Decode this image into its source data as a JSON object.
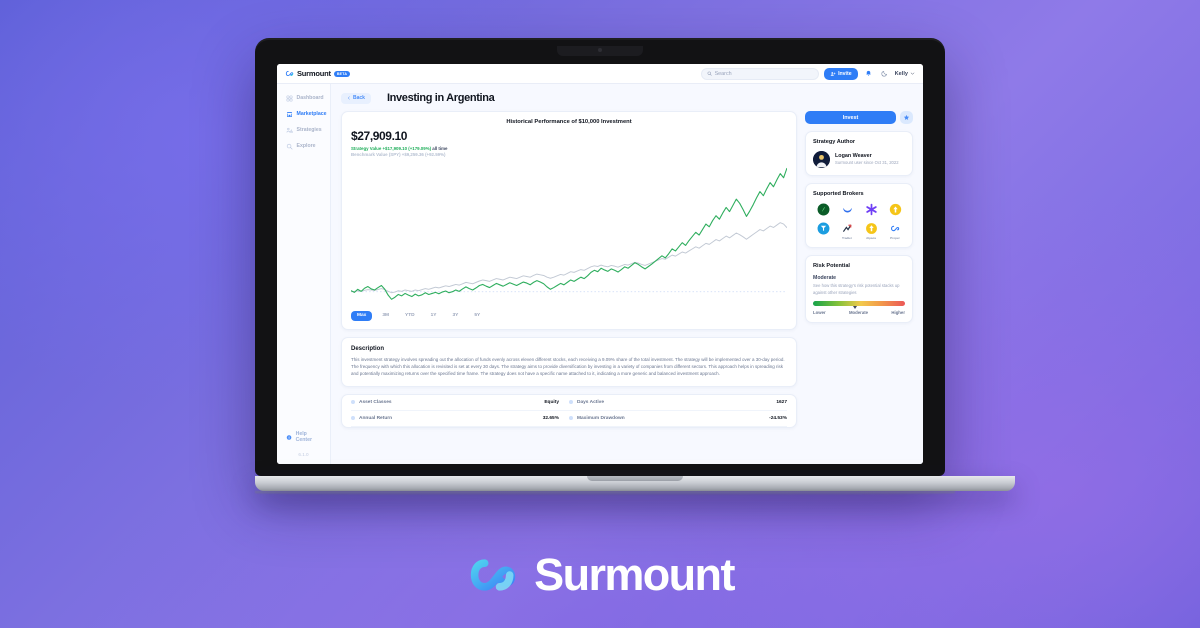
{
  "brand": {
    "name": "Surmount",
    "pill": "BETA",
    "footer_name": "Surmount",
    "logo_icon": "surmount-infinity-logo"
  },
  "topbar": {
    "search_placeholder": "Search",
    "invite_label": "Invite",
    "invite_icon": "add-people-icon",
    "notifications_icon": "bell-icon",
    "theme_icon": "moon-icon",
    "user_name": "Kelly",
    "user_caret": "⌄"
  },
  "sidebar": {
    "items": [
      {
        "label": "Dashboard",
        "icon": "dashboard-grid-icon",
        "active": false
      },
      {
        "label": "Marketplace",
        "icon": "storefront-icon",
        "active": true
      },
      {
        "label": "Strategies",
        "icon": "people-chart-icon",
        "active": false
      },
      {
        "label": "Explore",
        "icon": "magnifier-icon",
        "active": false
      }
    ],
    "help_label": "Help Center",
    "help_icon": "info-circle-icon",
    "version": "6.1.0"
  },
  "page": {
    "back_label": "Back",
    "back_icon": "chevron-left-icon",
    "title": "Investing in Argentina"
  },
  "chart_card": {
    "caption": "Historical Performance of $10,000 Investment",
    "big_value": "$27,909.10",
    "strategy_legend": "Strategy Value +$17,909.10 (+179.09%)",
    "strategy_period": "all time",
    "benchmark_legend": "Benchmark Value (SPY) +$9,259.36 (+92.59%)",
    "timeframes": [
      {
        "label": "Max",
        "active": true
      },
      {
        "label": "3M",
        "active": false
      },
      {
        "label": "YTD",
        "active": false
      },
      {
        "label": "1Y",
        "active": false
      },
      {
        "label": "3Y",
        "active": false
      },
      {
        "label": "5Y",
        "active": false
      }
    ]
  },
  "chart_data": {
    "type": "line",
    "title": "Historical Performance of $10,000 Investment",
    "xlabel": "",
    "ylabel": "",
    "grid": false,
    "legend_position": "top-left",
    "ylim": [
      8000,
      29000
    ],
    "baseline": 10000,
    "series": [
      {
        "name": "Strategy Value",
        "color": "#2fae5e",
        "values": [
          10150,
          9900,
          10350,
          10050,
          10500,
          10750,
          10400,
          10250,
          10600,
          10900,
          10350,
          9500,
          8900,
          9200,
          9600,
          9400,
          9750,
          9500,
          9300,
          9650,
          9400,
          9550,
          9850,
          9600,
          9750,
          9900,
          9700,
          9950,
          10100,
          9850,
          10000,
          10250,
          10050,
          10400,
          10700,
          10450,
          10250,
          10550,
          10900,
          11050,
          10800,
          10600,
          10900,
          11200,
          11000,
          10800,
          11050,
          11300,
          11100,
          10900,
          11150,
          11400,
          11250,
          11000,
          11350,
          11600,
          11400,
          11150,
          10700,
          10350,
          10600,
          10900,
          11200,
          11000,
          11350,
          11700,
          11500,
          11800,
          12100,
          11900,
          12300,
          12800,
          13100,
          12900,
          13400,
          13150,
          12950,
          13300,
          13100,
          12850,
          13200,
          13600,
          13400,
          13800,
          14200,
          13950,
          13600,
          13300,
          13650,
          14000,
          14400,
          14800,
          15200,
          14900,
          15500,
          16200,
          15900,
          16500,
          17100,
          16700,
          17400,
          18000,
          18600,
          18200,
          19000,
          19800,
          19400,
          20300,
          21000,
          20500,
          21400,
          22200,
          21600,
          22500,
          23400,
          22800,
          21900,
          20900,
          21700,
          22600,
          23600,
          24500,
          23900,
          24900,
          25800,
          25200,
          26200,
          27100,
          26500,
          27909
        ]
      },
      {
        "name": "Benchmark Value (SPY)",
        "color": "#c2c9d4",
        "values": [
          10000,
          10050,
          10120,
          10080,
          10200,
          10300,
          10250,
          10180,
          10320,
          10450,
          10300,
          10050,
          9850,
          9950,
          10150,
          10050,
          10250,
          10150,
          10050,
          10250,
          10150,
          10300,
          10450,
          10350,
          10500,
          10650,
          10550,
          10700,
          10850,
          10750,
          10900,
          11050,
          10950,
          11150,
          11350,
          11250,
          11150,
          11350,
          11550,
          11700,
          11600,
          11500,
          11700,
          11900,
          11800,
          11700,
          11900,
          12100,
          12000,
          11900,
          12100,
          12300,
          12200,
          12100,
          12350,
          12550,
          12450,
          12350,
          12100,
          11950,
          12100,
          12300,
          12500,
          12400,
          12650,
          12900,
          12800,
          13000,
          13200,
          13100,
          13350,
          13600,
          13750,
          13650,
          13850,
          13700,
          13600,
          13800,
          13700,
          13550,
          13750,
          13950,
          13850,
          14050,
          14250,
          14150,
          13950,
          13800,
          14000,
          14200,
          14400,
          14600,
          14800,
          14700,
          15000,
          15300,
          15150,
          15450,
          15750,
          15600,
          15900,
          16200,
          16500,
          16300,
          16650,
          17000,
          16850,
          17200,
          17550,
          17350,
          17700,
          18050,
          17800,
          18150,
          18500,
          18250,
          17950,
          17600,
          17950,
          18300,
          18650,
          19000,
          18800,
          19150,
          19500,
          19300,
          19650,
          20000,
          19800,
          19259
        ]
      }
    ]
  },
  "description": {
    "title": "Description",
    "body": "This investment strategy involves spreading out the allocation of funds evenly across eleven different stocks, each receiving a 9.09% share of the total investment. The strategy will be implemented over a 30-day period. The frequency with which this allocation is revisited is set at every 30 days. The strategy aims to provide diversification by investing in a variety of companies from different sectors. This approach helps in spreading risk and potentially maximizing returns over the specified time frame. The strategy does not have a specific name attached to it, indicating a more generic and balanced investment approach."
  },
  "stats": {
    "rows": [
      [
        {
          "label": "Asset Classes",
          "value": "Equity"
        },
        {
          "label": "Days Active",
          "value": "1627"
        }
      ],
      [
        {
          "label": "Annual Return",
          "value": "32.65%"
        },
        {
          "label": "Maximum Drawdown",
          "value": "-24.53%"
        }
      ]
    ]
  },
  "side": {
    "invest_label": "Invest",
    "favorite_icon": "star-icon",
    "author_card": {
      "title": "Strategy Author",
      "avatar_icon": "user-avatar",
      "name": "Logan Weaver",
      "subtitle": "Surmount user since Oct 31, 2022"
    },
    "brokers_card": {
      "title": "Supported Brokers",
      "brokers": [
        {
          "name": "",
          "icon": "robinhood-icon",
          "color": "#1f6b33"
        },
        {
          "name": "",
          "icon": "webull-icon",
          "color": "#2f6fed"
        },
        {
          "name": "",
          "icon": "alpaca-star-icon",
          "color": "#6f3ff5"
        },
        {
          "name": "",
          "icon": "kraken-icon",
          "color": "#f5c518"
        },
        {
          "name": "",
          "icon": "tradestation-icon",
          "color": "#1b9de0"
        },
        {
          "name": "Tradier",
          "icon": "tradier-icon",
          "color": "#1f2937"
        },
        {
          "name": "Alpaca",
          "icon": "alpaca-icon",
          "color": "#f5c518"
        },
        {
          "name": "Proper",
          "icon": "proper-icon",
          "color": "#2f7df6"
        }
      ]
    },
    "risk_card": {
      "title": "Risk Potential",
      "level": "Moderate",
      "description": "See how this strategy's risk potential stacks up against other strategies",
      "scale": [
        "Lower",
        "Moderate",
        "Higher"
      ],
      "marker_position_pct": 46
    }
  }
}
